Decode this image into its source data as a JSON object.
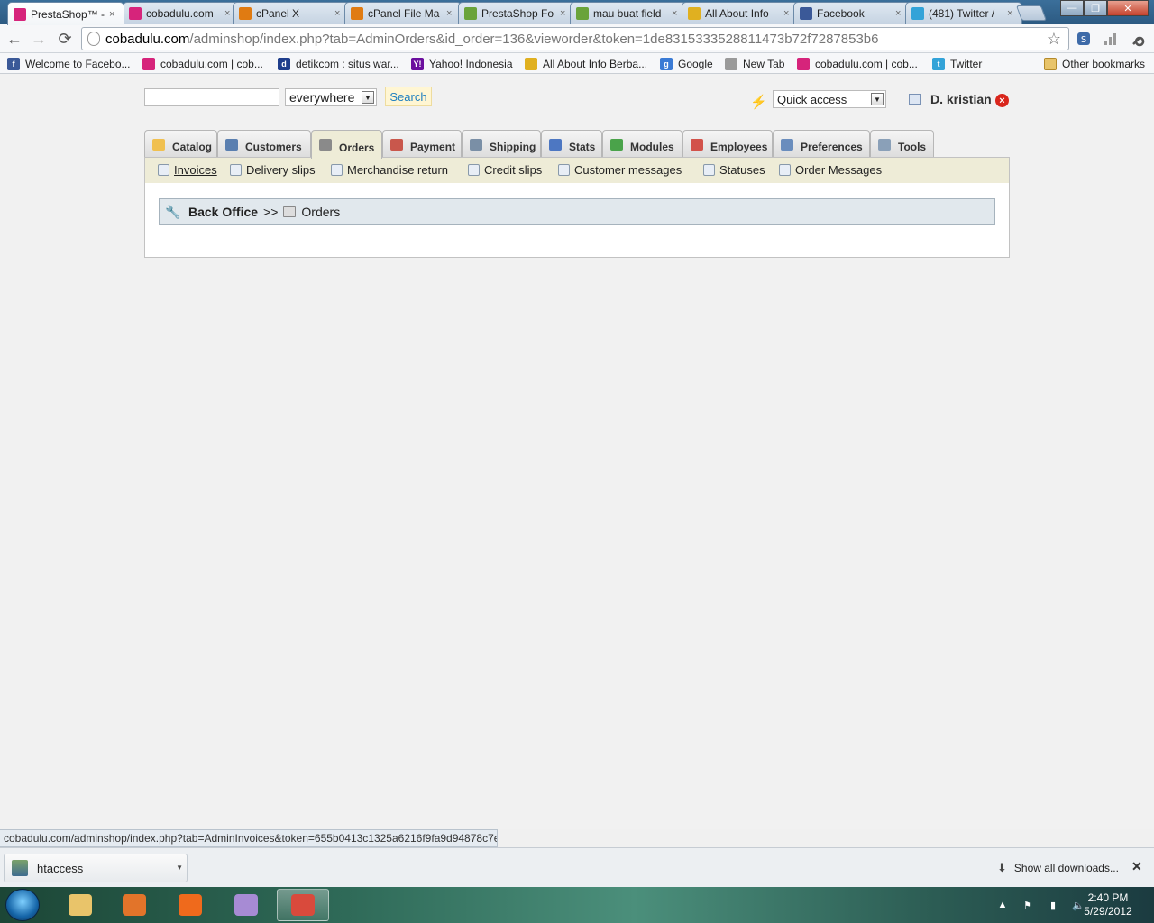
{
  "browser": {
    "tabs": [
      {
        "title": "PrestaShop™ -",
        "favicon": "cobadulu-icon",
        "color": "#d6247b",
        "active": true
      },
      {
        "title": "cobadulu.com",
        "favicon": "cobadulu-icon",
        "color": "#d6247b",
        "active": false
      },
      {
        "title": "cPanel X",
        "favicon": "cpanel-icon",
        "color": "#e07b12",
        "active": false
      },
      {
        "title": "cPanel File Ma",
        "favicon": "cpanel-icon",
        "color": "#e07b12",
        "active": false
      },
      {
        "title": "PrestaShop Fo",
        "favicon": "prestashop-forum-icon",
        "color": "#6aa33a",
        "active": false
      },
      {
        "title": "mau buat field",
        "favicon": "prestashop-forum-icon",
        "color": "#6aa33a",
        "active": false
      },
      {
        "title": "All About Info",
        "favicon": "allaboutinfo-icon",
        "color": "#e0b020",
        "active": false
      },
      {
        "title": "Facebook",
        "favicon": "facebook-icon",
        "color": "#3b5998",
        "active": false
      },
      {
        "title": "(481) Twitter /",
        "favicon": "twitter-icon",
        "color": "#33a3d8",
        "active": false
      }
    ],
    "tab_close_glyph": "×",
    "window_buttons": {
      "minimize": "—",
      "maximize": "❐",
      "close": "✕"
    },
    "nav": {
      "back": "←",
      "forward": "→",
      "reload": "⟳"
    },
    "address": {
      "host": "cobadulu.com",
      "path": "/adminshop/index.php?tab=AdminOrders&id_order=136&vieworder&token=1de8315333528811473b72f7287853b6"
    },
    "bookmark_star": "☆",
    "bookmarks": [
      {
        "label": "Welcome to Facebo...",
        "icon": "facebook-icon",
        "color": "#3b5998",
        "glyph": "f"
      },
      {
        "label": "cobadulu.com | cob...",
        "icon": "cobadulu-icon",
        "color": "#d6247b",
        "glyph": ""
      },
      {
        "label": "detikcom : situs war...",
        "icon": "detik-icon",
        "color": "#1f3e8c",
        "glyph": "d"
      },
      {
        "label": "Yahoo! Indonesia",
        "icon": "yahoo-icon",
        "color": "#6b0f9e",
        "glyph": "Y!"
      },
      {
        "label": "All About Info Berba...",
        "icon": "allaboutinfo-icon",
        "color": "#e0b020",
        "glyph": ""
      },
      {
        "label": "Google",
        "icon": "google-icon",
        "color": "#3a7bd5",
        "glyph": "g"
      },
      {
        "label": "New Tab",
        "icon": "newtab-icon",
        "color": "#9a9a9a",
        "glyph": ""
      },
      {
        "label": "cobadulu.com | cob...",
        "icon": "cobadulu-icon",
        "color": "#d6247b",
        "glyph": ""
      },
      {
        "label": "Twitter",
        "icon": "twitter-icon",
        "color": "#33a3d8",
        "glyph": "t"
      }
    ],
    "other_bookmarks": "Other bookmarks"
  },
  "admin": {
    "search": {
      "value": "",
      "scope": "everywhere",
      "button": "Search"
    },
    "quick_access": "Quick access",
    "employee": "D. kristian",
    "main_tabs": [
      {
        "label": "Catalog",
        "icon": "folder-icon",
        "color": "#f0c050",
        "active": false
      },
      {
        "label": "Customers",
        "icon": "customer-icon",
        "color": "#5a7fb0",
        "active": false
      },
      {
        "label": "Orders",
        "icon": "cart-icon",
        "color": "#8a8a8a",
        "active": true
      },
      {
        "label": "Payment",
        "icon": "payment-icon",
        "color": "#c9574c",
        "active": false
      },
      {
        "label": "Shipping",
        "icon": "truck-icon",
        "color": "#7a8fa6",
        "active": false
      },
      {
        "label": "Stats",
        "icon": "chart-icon",
        "color": "#4d77c2",
        "active": false
      },
      {
        "label": "Modules",
        "icon": "puzzle-icon",
        "color": "#4aa34a",
        "active": false
      },
      {
        "label": "Employees",
        "icon": "employee-icon",
        "color": "#d2524a",
        "active": false
      },
      {
        "label": "Preferences",
        "icon": "preferences-icon",
        "color": "#6a8dbd",
        "active": false
      },
      {
        "label": "Tools",
        "icon": "wrench-icon",
        "color": "#8aa0b8",
        "active": false
      }
    ],
    "sub_tabs": [
      {
        "label": "Invoices",
        "icon": "invoice-icon",
        "current": true
      },
      {
        "label": "Delivery slips",
        "icon": "delivery-truck-icon",
        "current": false
      },
      {
        "label": "Merchandise return",
        "icon": "return-icon",
        "current": false
      },
      {
        "label": "Credit slips",
        "icon": "credit-slip-icon",
        "current": false
      },
      {
        "label": "Customer messages",
        "icon": "message-icon",
        "current": false
      },
      {
        "label": "Statuses",
        "icon": "status-icon",
        "current": false
      },
      {
        "label": "Order Messages",
        "icon": "order-message-icon",
        "current": false
      }
    ],
    "breadcrumb": {
      "home": "Back Office",
      "separator": ">>",
      "current": "Orders"
    }
  },
  "statusbar": {
    "url": "cobadulu.com/adminshop/index.php?tab=AdminInvoices&token=655b0413c1325a6216f9fa9d94878c7e"
  },
  "downloads": {
    "item": "htaccess",
    "show_all": "Show all downloads..."
  },
  "taskbar": {
    "apps": [
      {
        "name": "explorer",
        "icon": "folder-icon",
        "color": "#e9c46a",
        "running": false
      },
      {
        "name": "media",
        "icon": "media-player-icon",
        "color": "#e2742a",
        "running": false
      },
      {
        "name": "mail",
        "icon": "mail-icon",
        "color": "#ef6a1c",
        "running": false
      },
      {
        "name": "messenger",
        "icon": "messenger-icon",
        "color": "#a78bd4",
        "running": false
      },
      {
        "name": "chrome",
        "icon": "chrome-icon",
        "color": "#d94a3c",
        "running": true
      }
    ],
    "clock_time": "2:40 PM",
    "clock_date": "5/29/2012"
  }
}
